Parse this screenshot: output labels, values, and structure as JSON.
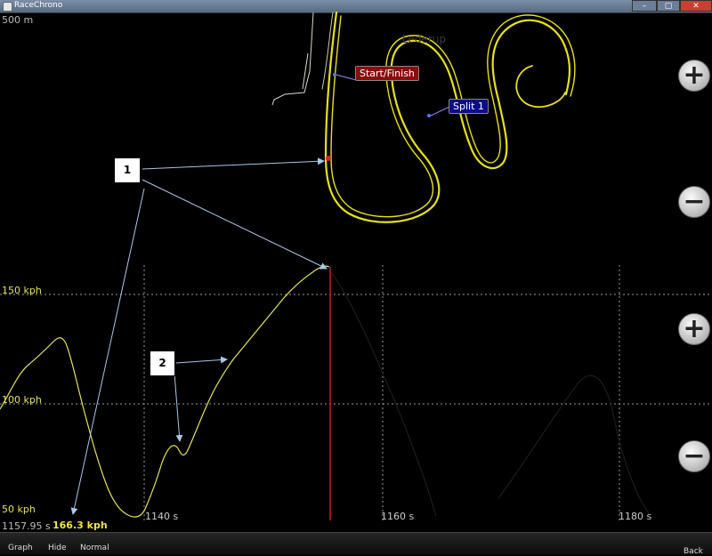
{
  "window": {
    "title": "RaceChrono",
    "minimize": "–",
    "maximize": "▢",
    "close": "✕"
  },
  "map": {
    "scale_label": "500 m",
    "track_name": "Lederup",
    "start_finish_label": "Start/Finish",
    "split_label": "Split 1",
    "track_color": "#e8e020"
  },
  "graph": {
    "speed_labels": [
      "150 kph",
      "100 kph",
      "50 kph"
    ],
    "time_labels": [
      "1140 s",
      "1160 s",
      "1180 s"
    ],
    "cursor_time": "1157.95 s",
    "cursor_speed": "166.3 kph",
    "curve_color": "#e8e25a",
    "cursor_color": "#d02020"
  },
  "annotations": {
    "callout_1": "1",
    "callout_2": "2"
  },
  "zoom_buttons": {
    "zoom_in": "+",
    "zoom_out": "−"
  },
  "menu": {
    "graph": "Graph",
    "hide": "Hide",
    "normal": "Normal",
    "back": "Back"
  }
}
